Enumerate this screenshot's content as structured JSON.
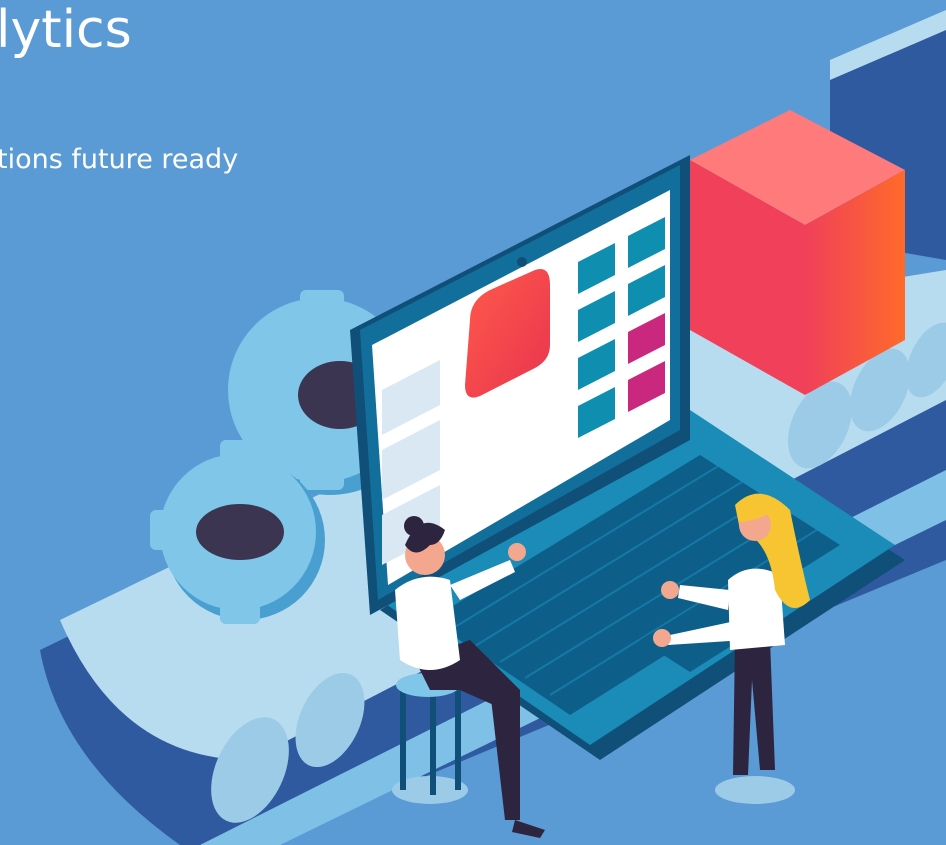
{
  "hero": {
    "title": "lytics",
    "subtitle": "tions future ready"
  },
  "colors": {
    "background": "#5b9bd5",
    "text": "#ffffff",
    "belt_dark": "#2f5aa0",
    "belt_light": "#b8dcef",
    "gear": "#67b7dc",
    "screen": "#126f9c",
    "tile_teal": "#0f8fb0",
    "tile_magenta": "#c9287e",
    "cube_red": "#f25b5b",
    "cube_orange": "#ff7a2e"
  },
  "illustration": {
    "subject": "isometric laptop on conveyor belt with gears, cube and two people",
    "icon": "analytics-illustration-icon"
  }
}
